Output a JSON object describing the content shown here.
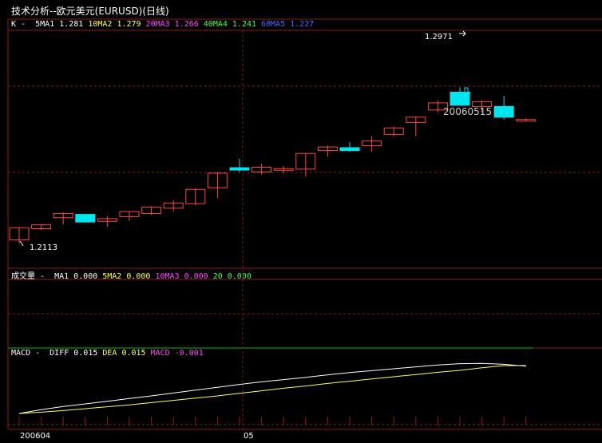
{
  "window": {
    "title": "技术分析--欧元美元(EURUSD)(日线)"
  },
  "price_panel": {
    "label": "K",
    "ma": [
      {
        "name": "5MA1",
        "value": "1.281",
        "color": "#ffffff"
      },
      {
        "name": "10MA2",
        "value": "1.279",
        "color": "#ffff44"
      },
      {
        "name": "20MA3",
        "value": "1.266",
        "color": "#ff44ff"
      },
      {
        "name": "40MA4",
        "value": "1.241",
        "color": "#44ff44"
      },
      {
        "name": "60MA5",
        "value": "1.227",
        "color": "#4466ff"
      }
    ],
    "high_label": "1.2971",
    "low_label": "1.2113",
    "date_label": "20060515"
  },
  "volume_panel": {
    "label": "成交量",
    "ma": [
      {
        "name": "MA1",
        "value": "0.000",
        "color": "#ffffff"
      },
      {
        "name": "5MA2",
        "value": "0.000",
        "color": "#ffff44"
      },
      {
        "name": "10MA3",
        "value": "0.000",
        "color": "#ff44ff"
      },
      {
        "name": "20",
        "value": "0.000",
        "color": "#44ff44"
      }
    ]
  },
  "macd_panel": {
    "label": "MACD",
    "items": [
      {
        "name": "DIFF",
        "value": "0.015",
        "color": "#ffffff"
      },
      {
        "name": "DEA",
        "value": "0.015",
        "color": "#ffff44"
      },
      {
        "name": "MACD",
        "value": "-0.001",
        "color": "#ff44ff"
      }
    ]
  },
  "x_axis": {
    "start_label": "200604",
    "mid_label": "05"
  },
  "colors": {
    "up": "#ff4444",
    "down": "#00e5ee",
    "grid": "#8b1a1a"
  },
  "chart_data": {
    "type": "candlestick",
    "candles": [
      {
        "o": 1.2125,
        "h": 1.2178,
        "l": 1.211,
        "c": 1.2176
      },
      {
        "o": 1.2172,
        "h": 1.219,
        "l": 1.2166,
        "c": 1.2188
      },
      {
        "o": 1.2218,
        "h": 1.224,
        "l": 1.219,
        "c": 1.2236
      },
      {
        "o": 1.2232,
        "h": 1.2232,
        "l": 1.2197,
        "c": 1.22
      },
      {
        "o": 1.2203,
        "h": 1.2225,
        "l": 1.218,
        "c": 1.2214
      },
      {
        "o": 1.2222,
        "h": 1.2245,
        "l": 1.2205,
        "c": 1.2244
      },
      {
        "o": 1.2236,
        "h": 1.2266,
        "l": 1.223,
        "c": 1.2262
      },
      {
        "o": 1.2258,
        "h": 1.229,
        "l": 1.2245,
        "c": 1.228
      },
      {
        "o": 1.2277,
        "h": 1.234,
        "l": 1.227,
        "c": 1.2337
      },
      {
        "o": 1.2344,
        "h": 1.241,
        "l": 1.23,
        "c": 1.2405
      },
      {
        "o": 1.2428,
        "h": 1.2465,
        "l": 1.241,
        "c": 1.2418
      },
      {
        "o": 1.241,
        "h": 1.2445,
        "l": 1.24,
        "c": 1.243
      },
      {
        "o": 1.2418,
        "h": 1.2435,
        "l": 1.2405,
        "c": 1.2424
      },
      {
        "o": 1.2422,
        "h": 1.249,
        "l": 1.239,
        "c": 1.2488
      },
      {
        "o": 1.25,
        "h": 1.252,
        "l": 1.2475,
        "c": 1.2515
      },
      {
        "o": 1.2512,
        "h": 1.2535,
        "l": 1.2495,
        "c": 1.25
      },
      {
        "o": 1.252,
        "h": 1.256,
        "l": 1.2495,
        "c": 1.254
      },
      {
        "o": 1.2568,
        "h": 1.26,
        "l": 1.256,
        "c": 1.2595
      },
      {
        "o": 1.2618,
        "h": 1.264,
        "l": 1.256,
        "c": 1.264
      },
      {
        "o": 1.267,
        "h": 1.271,
        "l": 1.266,
        "c": 1.27
      },
      {
        "o": 1.2745,
        "h": 1.2765,
        "l": 1.271,
        "c": 1.269
      },
      {
        "o": 1.2685,
        "h": 1.271,
        "l": 1.266,
        "c": 1.2705
      },
      {
        "o": 1.2685,
        "h": 1.273,
        "l": 1.263,
        "c": 1.264
      },
      {
        "o": 1.263,
        "h": 1.2635,
        "l": 1.2622,
        "c": 1.263
      }
    ],
    "diff": [
      0.0,
      0.0012,
      0.0022,
      0.003,
      0.0038,
      0.0047,
      0.0055,
      0.0064,
      0.0073,
      0.0082,
      0.0091,
      0.0099,
      0.0106,
      0.0113,
      0.0121,
      0.0128,
      0.0134,
      0.014,
      0.0146,
      0.0152,
      0.0156,
      0.0157,
      0.0154,
      0.0148
    ],
    "dea": [
      0.0,
      0.0004,
      0.0009,
      0.0015,
      0.0021,
      0.0027,
      0.0034,
      0.0041,
      0.0048,
      0.0055,
      0.0063,
      0.0071,
      0.0079,
      0.0086,
      0.0094,
      0.0101,
      0.0108,
      0.0115,
      0.0122,
      0.0129,
      0.0135,
      0.0143,
      0.015,
      0.015
    ]
  }
}
